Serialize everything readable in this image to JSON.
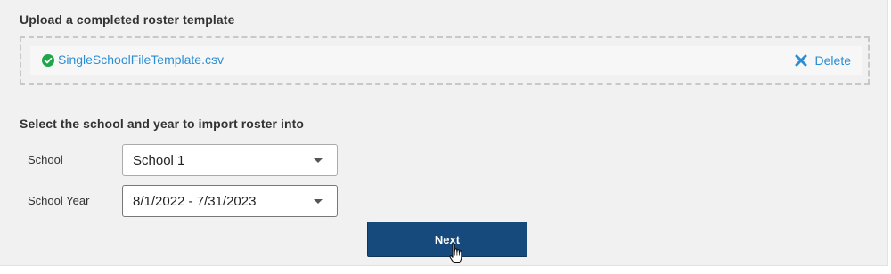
{
  "upload": {
    "heading": "Upload a completed roster template",
    "file_name": "SingleSchoolFileTemplate.csv",
    "delete_label": "Delete",
    "file_status_icon": "check-circle-icon"
  },
  "import_target": {
    "heading": "Select the school and year to import roster into",
    "school": {
      "label": "School",
      "value": "School 1"
    },
    "school_year": {
      "label": "School Year",
      "value": "8/1/2022 - 7/31/2023"
    }
  },
  "actions": {
    "next_label": "Next"
  },
  "colors": {
    "accent_link": "#2b8ed3",
    "primary_button": "#174a7c",
    "success": "#1fa64a",
    "panel_bg": "#f1f1f1"
  }
}
